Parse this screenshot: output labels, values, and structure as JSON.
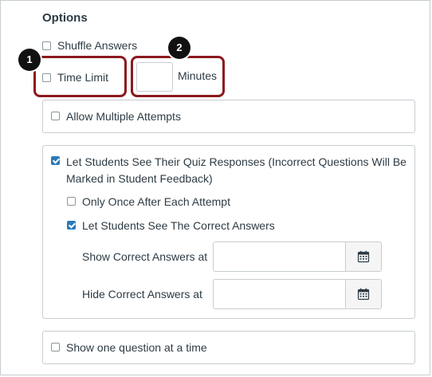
{
  "options": {
    "heading": "Options",
    "shuffle_answers": {
      "label": "Shuffle Answers",
      "checked": false
    },
    "time_limit": {
      "label": "Time Limit",
      "checked": false,
      "minutes_value": "",
      "minutes_label": "Minutes"
    },
    "allow_multiple_attempts": {
      "label": "Allow Multiple Attempts",
      "checked": false
    },
    "see_responses": {
      "label_line1": "Let Students See Their Quiz Responses (Incorrect Questions Will Be",
      "label_line2": "Marked in Student Feedback)",
      "checked": true,
      "only_once": {
        "label": "Only Once After Each Attempt",
        "checked": false
      },
      "see_correct": {
        "label": "Let Students See The Correct Answers",
        "checked": true
      },
      "show_correct_at": {
        "label": "Show Correct Answers at",
        "value": ""
      },
      "hide_correct_at": {
        "label": "Hide Correct Answers at",
        "value": ""
      }
    },
    "one_question": {
      "label": "Show one question at a time",
      "checked": false
    }
  },
  "callouts": [
    {
      "number": "1"
    },
    {
      "number": "2"
    }
  ],
  "icons": {
    "calendar": "calendar-icon"
  },
  "colors": {
    "callout": "#8b1a1e",
    "checkbox_checked": "#2b7abc",
    "text": "#2d3b45",
    "border": "#c7cdd1"
  }
}
